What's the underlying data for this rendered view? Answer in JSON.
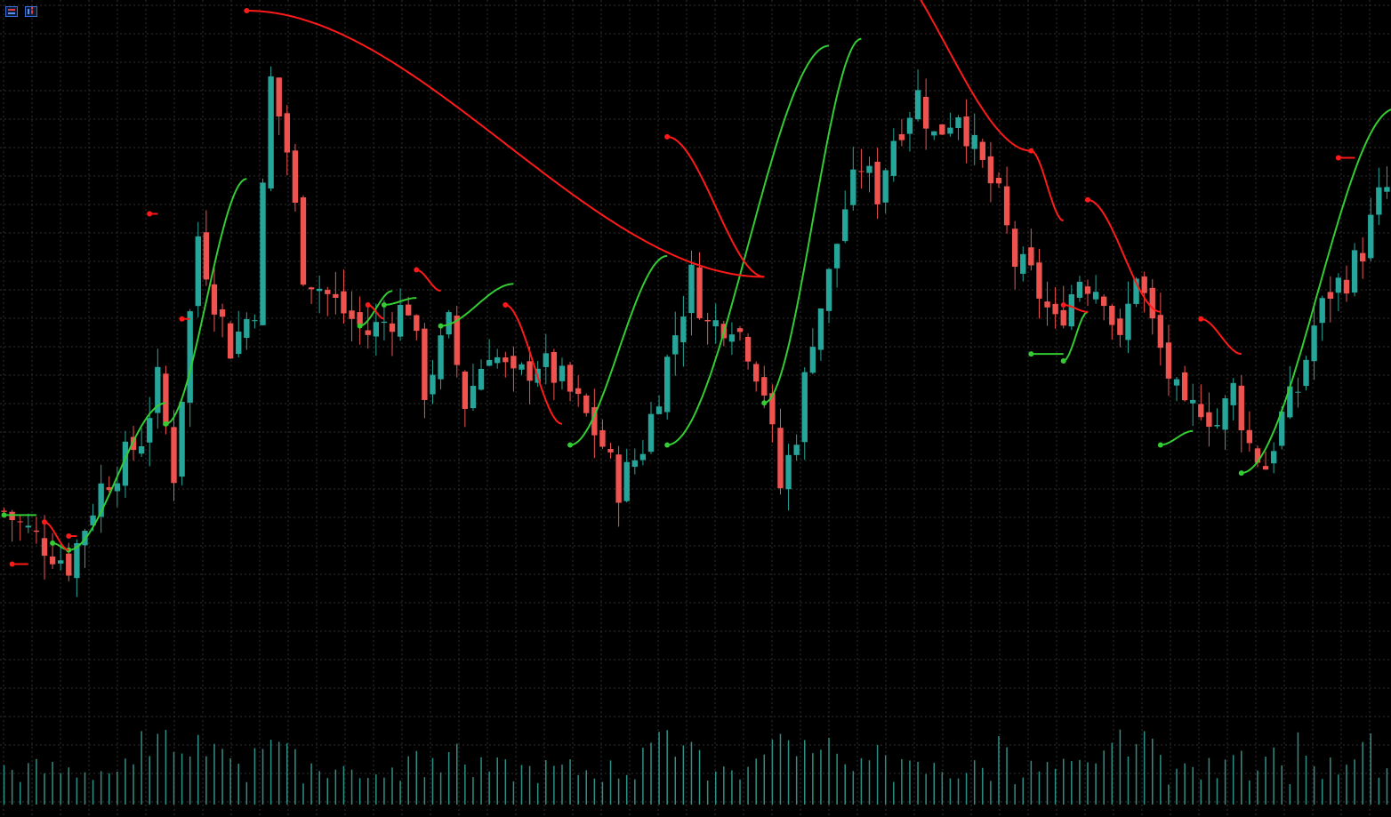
{
  "toolbar": {
    "icons": [
      "objects-list-icon",
      "trading-panel-icon"
    ]
  },
  "colors": {
    "background": "#000000",
    "grid": "#2f2f2f",
    "candle_up": "#26a69a",
    "candle_down": "#ef5350",
    "trail_support": "#33cc33",
    "trail_resistance": "#ff1a1a",
    "volume": "#2f8f86"
  },
  "chart_data": {
    "type": "candlestick",
    "title": "",
    "xlabel": "",
    "ylabel": "",
    "grid": true,
    "legend": "none",
    "ylim": [
      0,
      100
    ],
    "anchors": [
      [
        0,
        28.5
      ],
      [
        8,
        21
      ],
      [
        12,
        32
      ],
      [
        17,
        39
      ],
      [
        19,
        47
      ],
      [
        21,
        34
      ],
      [
        24,
        68
      ],
      [
        26,
        59
      ],
      [
        28,
        52
      ],
      [
        31,
        58
      ],
      [
        33,
        90
      ],
      [
        35,
        80
      ],
      [
        37,
        63
      ],
      [
        42,
        57
      ],
      [
        45,
        54
      ],
      [
        50,
        58
      ],
      [
        52,
        46
      ],
      [
        55,
        55
      ],
      [
        57,
        44
      ],
      [
        60,
        52
      ],
      [
        63,
        47
      ],
      [
        66,
        50
      ],
      [
        69,
        47
      ],
      [
        72,
        42
      ],
      [
        74,
        38
      ],
      [
        76,
        32
      ],
      [
        79,
        38
      ],
      [
        82,
        50
      ],
      [
        85,
        62
      ],
      [
        87,
        55
      ],
      [
        90,
        56
      ],
      [
        92,
        52
      ],
      [
        94,
        46
      ],
      [
        96,
        32
      ],
      [
        98,
        40
      ],
      [
        100,
        54
      ],
      [
        102,
        62
      ],
      [
        104,
        72
      ],
      [
        106,
        78
      ],
      [
        108,
        74
      ],
      [
        110,
        82
      ],
      [
        113,
        88
      ],
      [
        115,
        82
      ],
      [
        118,
        86
      ],
      [
        120,
        80
      ],
      [
        123,
        73
      ],
      [
        125,
        64
      ],
      [
        127,
        62
      ],
      [
        130,
        55
      ],
      [
        133,
        62
      ],
      [
        136,
        60
      ],
      [
        138,
        52
      ],
      [
        140,
        63
      ],
      [
        142,
        55
      ],
      [
        144,
        48
      ],
      [
        146,
        42
      ],
      [
        148,
        44
      ],
      [
        150,
        41
      ],
      [
        152,
        46
      ],
      [
        154,
        38
      ],
      [
        156,
        35
      ],
      [
        158,
        42
      ],
      [
        160,
        46
      ],
      [
        162,
        55
      ],
      [
        164,
        60
      ],
      [
        166,
        62
      ],
      [
        168,
        66
      ],
      [
        170,
        73
      ],
      [
        172,
        76
      ]
    ],
    "candle_count": 172,
    "volume_bars": 172,
    "trailing_stop": {
      "support": [
        {
          "from": 0,
          "to": 4,
          "start": 28,
          "end": 28
        },
        {
          "from": 6,
          "to": 8,
          "start": 24,
          "end": 23
        },
        {
          "from": 8,
          "to": 20,
          "start": 23,
          "end": 44
        },
        {
          "from": 20,
          "to": 30,
          "start": 41,
          "end": 76
        },
        {
          "from": 44,
          "to": 48,
          "start": 55,
          "end": 60
        },
        {
          "from": 47,
          "to": 51,
          "start": 58,
          "end": 59
        },
        {
          "from": 54,
          "to": 63,
          "start": 55,
          "end": 61
        },
        {
          "from": 70,
          "to": 82,
          "start": 38,
          "end": 65
        },
        {
          "from": 82,
          "to": 102,
          "start": 38,
          "end": 95
        },
        {
          "from": 94,
          "to": 106,
          "start": 44,
          "end": 96
        },
        {
          "from": 127,
          "to": 131,
          "start": 51,
          "end": 51
        },
        {
          "from": 131,
          "to": 134,
          "start": 50,
          "end": 57
        },
        {
          "from": 143,
          "to": 147,
          "start": 38,
          "end": 40
        },
        {
          "from": 153,
          "to": 172,
          "start": 34,
          "end": 86
        }
      ],
      "resistance": [
        {
          "from": 1,
          "to": 3,
          "start": 21,
          "end": 21
        },
        {
          "from": 5,
          "to": 8,
          "start": 27,
          "end": 23
        },
        {
          "from": 8,
          "to": 9,
          "start": 25,
          "end": 25
        },
        {
          "from": 18,
          "to": 19,
          "start": 71,
          "end": 71
        },
        {
          "from": 22,
          "to": 23,
          "start": 56,
          "end": 56
        },
        {
          "from": 30,
          "to": 94,
          "start": 100,
          "end": 62
        },
        {
          "from": 45,
          "to": 47,
          "start": 58,
          "end": 56
        },
        {
          "from": 51,
          "to": 54,
          "start": 63,
          "end": 60
        },
        {
          "from": 62,
          "to": 69,
          "start": 58,
          "end": 41
        },
        {
          "from": 82,
          "to": 94,
          "start": 82,
          "end": 62
        },
        {
          "from": 106,
          "to": 127,
          "start": 110,
          "end": 80
        },
        {
          "from": 127,
          "to": 131,
          "start": 80,
          "end": 70
        },
        {
          "from": 131,
          "to": 134,
          "start": 58,
          "end": 57
        },
        {
          "from": 134,
          "to": 143,
          "start": 73,
          "end": 57
        },
        {
          "from": 148,
          "to": 153,
          "start": 56,
          "end": 51
        },
        {
          "from": 165,
          "to": 167,
          "start": 79,
          "end": 79
        }
      ]
    }
  }
}
